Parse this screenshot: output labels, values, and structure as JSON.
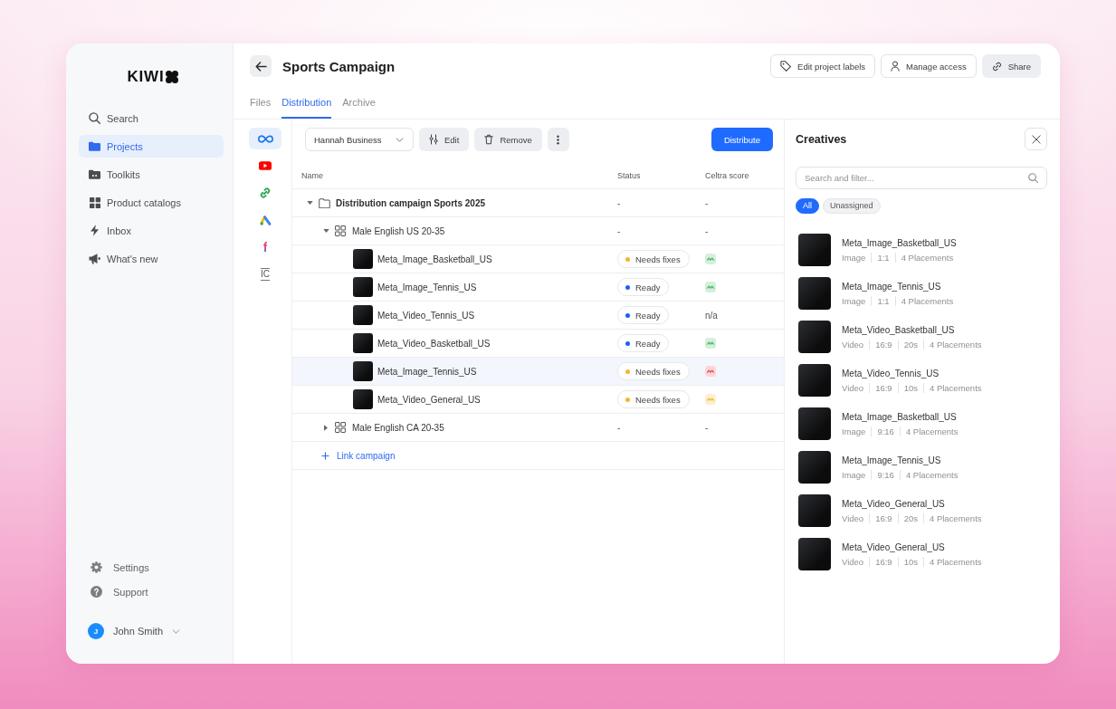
{
  "sidebar": {
    "logo": {
      "text": "KIWI"
    },
    "nav_items": [
      {
        "label": "Search",
        "selected": false
      },
      {
        "label": "Projects",
        "selected": true
      },
      {
        "label": "Toolkits",
        "selected": false
      },
      {
        "label": "Product catalogs",
        "selected": false
      },
      {
        "label": "Inbox",
        "selected": false
      },
      {
        "label": "What's new",
        "selected": false
      }
    ],
    "footer_items": [
      {
        "label": "Settings"
      },
      {
        "label": "Support"
      }
    ],
    "user": {
      "initial": "J",
      "name": "John Smith"
    }
  },
  "header": {
    "title": "Sports Campaign",
    "buttons": [
      {
        "label": "Edit project labels",
        "kind": "outline"
      },
      {
        "label": "Manage access",
        "kind": "outline"
      },
      {
        "label": "Share",
        "kind": "filled"
      }
    ],
    "tabs": [
      {
        "label": "Files",
        "selected": false
      },
      {
        "label": "Distribution",
        "selected": true
      },
      {
        "label": "Archive",
        "selected": false
      }
    ]
  },
  "channels": [
    {
      "selected": true
    },
    {
      "selected": false
    },
    {
      "selected": false
    },
    {
      "selected": false
    },
    {
      "selected": false,
      "glyph": "f"
    },
    {
      "selected": false,
      "glyph": "IC"
    }
  ],
  "toolbar": {
    "account_select": {
      "value": "Hannah Business"
    },
    "actions": [
      {
        "label": "Edit"
      },
      {
        "label": "Remove"
      }
    ],
    "primary_action": {
      "label": "Distribute"
    }
  },
  "table": {
    "columns": [
      "Name",
      "Status",
      "Celtra score"
    ],
    "rows": [
      {
        "kind": "campaign",
        "name": "Distribution campaign Sports 2025",
        "expanded": true,
        "status_text": "-",
        "score_text": "-",
        "children": [
          {
            "kind": "ad_set",
            "name": "Male English US 20-35",
            "expanded": true,
            "status_text": "-",
            "score_text": "-",
            "children": [
              {
                "kind": "creative",
                "name": "Meta_Image_Basketball_US",
                "selected": false,
                "status": {
                  "label": "Needs fixes",
                  "color": "#f5b335"
                },
                "score": {
                  "color": "#d4efdb"
                }
              },
              {
                "kind": "creative",
                "name": "Meta_Image_Tennis_US",
                "selected": false,
                "status": {
                  "label": "Ready",
                  "color": "#1d5ff5"
                },
                "score": {
                  "color": "#d4efdb"
                }
              },
              {
                "kind": "creative",
                "name": "Meta_Video_Tennis_US",
                "selected": false,
                "status": {
                  "label": "Ready",
                  "color": "#1d5ff5"
                },
                "score_text": "n/a"
              },
              {
                "kind": "creative",
                "name": "Meta_Video_Basketball_US",
                "selected": false,
                "status": {
                  "label": "Ready",
                  "color": "#1d5ff5"
                },
                "score": {
                  "color": "#d4efdb"
                }
              },
              {
                "kind": "creative",
                "name": "Meta_Image_Tennis_US",
                "selected": true,
                "status": {
                  "label": "Needs fixes",
                  "color": "#f5b335"
                },
                "score": {
                  "color": "#f9d7d8"
                }
              },
              {
                "kind": "creative",
                "name": "Meta_Video_General_US",
                "selected": false,
                "status": {
                  "label": "Needs fixes",
                  "color": "#f5b335"
                },
                "score": {
                  "color": "#fcefd0"
                }
              }
            ]
          },
          {
            "kind": "ad_set",
            "name": "Male English CA 20-35",
            "expanded": false,
            "status_text": "-",
            "score_text": "-"
          }
        ]
      }
    ],
    "link_action": {
      "label": "Link campaign"
    }
  },
  "creatives_panel": {
    "title": "Creatives",
    "search": {
      "placeholder": "Search and filter..."
    },
    "filters": [
      {
        "label": "All",
        "selected": true
      },
      {
        "label": "Unassigned",
        "selected": false
      }
    ],
    "items": [
      {
        "name": "Meta_Image_Basketball_US",
        "details": [
          "Image",
          "1:1",
          "4 Placements"
        ]
      },
      {
        "name": "Meta_Image_Tennis_US",
        "details": [
          "Image",
          "1:1",
          "4 Placements"
        ]
      },
      {
        "name": "Meta_Video_Basketball_US",
        "details": [
          "Video",
          "16:9",
          "20s",
          "4 Placements"
        ]
      },
      {
        "name": "Meta_Video_Tennis_US",
        "details": [
          "Video",
          "16:9",
          "10s",
          "4 Placements"
        ]
      },
      {
        "name": "Meta_Image_Basketball_US",
        "details": [
          "Image",
          "9:16",
          "4 Placements"
        ]
      },
      {
        "name": "Meta_Image_Tennis_US",
        "details": [
          "Image",
          "9:16",
          "4 Placements"
        ]
      },
      {
        "name": "Meta_Video_General_US",
        "details": [
          "Video",
          "16:9",
          "20s",
          "4 Placements"
        ]
      },
      {
        "name": "Meta_Video_General_US",
        "details": [
          "Video",
          "16:9",
          "10s",
          "4 Placements"
        ]
      }
    ]
  }
}
